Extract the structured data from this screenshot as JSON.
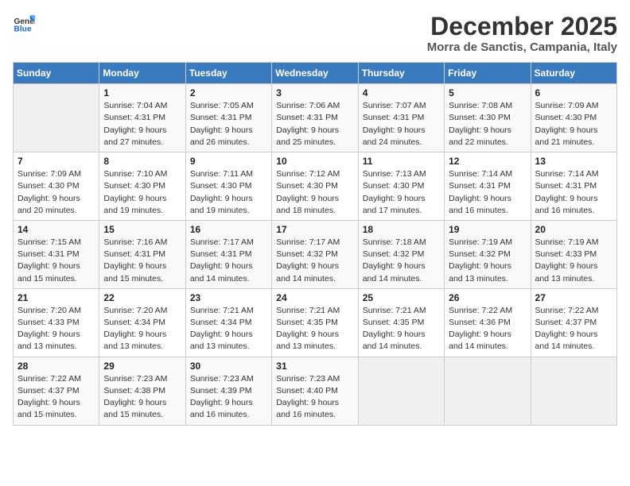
{
  "logo": {
    "line1": "General",
    "line2": "Blue"
  },
  "title": {
    "month_year": "December 2025",
    "location": "Morra de Sanctis, Campania, Italy"
  },
  "days_of_week": [
    "Sunday",
    "Monday",
    "Tuesday",
    "Wednesday",
    "Thursday",
    "Friday",
    "Saturday"
  ],
  "weeks": [
    [
      {
        "day": "",
        "info": ""
      },
      {
        "day": "1",
        "info": "Sunrise: 7:04 AM\nSunset: 4:31 PM\nDaylight: 9 hours\nand 27 minutes."
      },
      {
        "day": "2",
        "info": "Sunrise: 7:05 AM\nSunset: 4:31 PM\nDaylight: 9 hours\nand 26 minutes."
      },
      {
        "day": "3",
        "info": "Sunrise: 7:06 AM\nSunset: 4:31 PM\nDaylight: 9 hours\nand 25 minutes."
      },
      {
        "day": "4",
        "info": "Sunrise: 7:07 AM\nSunset: 4:31 PM\nDaylight: 9 hours\nand 24 minutes."
      },
      {
        "day": "5",
        "info": "Sunrise: 7:08 AM\nSunset: 4:30 PM\nDaylight: 9 hours\nand 22 minutes."
      },
      {
        "day": "6",
        "info": "Sunrise: 7:09 AM\nSunset: 4:30 PM\nDaylight: 9 hours\nand 21 minutes."
      }
    ],
    [
      {
        "day": "7",
        "info": "Sunrise: 7:09 AM\nSunset: 4:30 PM\nDaylight: 9 hours\nand 20 minutes."
      },
      {
        "day": "8",
        "info": "Sunrise: 7:10 AM\nSunset: 4:30 PM\nDaylight: 9 hours\nand 19 minutes."
      },
      {
        "day": "9",
        "info": "Sunrise: 7:11 AM\nSunset: 4:30 PM\nDaylight: 9 hours\nand 19 minutes."
      },
      {
        "day": "10",
        "info": "Sunrise: 7:12 AM\nSunset: 4:30 PM\nDaylight: 9 hours\nand 18 minutes."
      },
      {
        "day": "11",
        "info": "Sunrise: 7:13 AM\nSunset: 4:30 PM\nDaylight: 9 hours\nand 17 minutes."
      },
      {
        "day": "12",
        "info": "Sunrise: 7:14 AM\nSunset: 4:31 PM\nDaylight: 9 hours\nand 16 minutes."
      },
      {
        "day": "13",
        "info": "Sunrise: 7:14 AM\nSunset: 4:31 PM\nDaylight: 9 hours\nand 16 minutes."
      }
    ],
    [
      {
        "day": "14",
        "info": "Sunrise: 7:15 AM\nSunset: 4:31 PM\nDaylight: 9 hours\nand 15 minutes."
      },
      {
        "day": "15",
        "info": "Sunrise: 7:16 AM\nSunset: 4:31 PM\nDaylight: 9 hours\nand 15 minutes."
      },
      {
        "day": "16",
        "info": "Sunrise: 7:17 AM\nSunset: 4:31 PM\nDaylight: 9 hours\nand 14 minutes."
      },
      {
        "day": "17",
        "info": "Sunrise: 7:17 AM\nSunset: 4:32 PM\nDaylight: 9 hours\nand 14 minutes."
      },
      {
        "day": "18",
        "info": "Sunrise: 7:18 AM\nSunset: 4:32 PM\nDaylight: 9 hours\nand 14 minutes."
      },
      {
        "day": "19",
        "info": "Sunrise: 7:19 AM\nSunset: 4:32 PM\nDaylight: 9 hours\nand 13 minutes."
      },
      {
        "day": "20",
        "info": "Sunrise: 7:19 AM\nSunset: 4:33 PM\nDaylight: 9 hours\nand 13 minutes."
      }
    ],
    [
      {
        "day": "21",
        "info": "Sunrise: 7:20 AM\nSunset: 4:33 PM\nDaylight: 9 hours\nand 13 minutes."
      },
      {
        "day": "22",
        "info": "Sunrise: 7:20 AM\nSunset: 4:34 PM\nDaylight: 9 hours\nand 13 minutes."
      },
      {
        "day": "23",
        "info": "Sunrise: 7:21 AM\nSunset: 4:34 PM\nDaylight: 9 hours\nand 13 minutes."
      },
      {
        "day": "24",
        "info": "Sunrise: 7:21 AM\nSunset: 4:35 PM\nDaylight: 9 hours\nand 13 minutes."
      },
      {
        "day": "25",
        "info": "Sunrise: 7:21 AM\nSunset: 4:35 PM\nDaylight: 9 hours\nand 14 minutes."
      },
      {
        "day": "26",
        "info": "Sunrise: 7:22 AM\nSunset: 4:36 PM\nDaylight: 9 hours\nand 14 minutes."
      },
      {
        "day": "27",
        "info": "Sunrise: 7:22 AM\nSunset: 4:37 PM\nDaylight: 9 hours\nand 14 minutes."
      }
    ],
    [
      {
        "day": "28",
        "info": "Sunrise: 7:22 AM\nSunset: 4:37 PM\nDaylight: 9 hours\nand 15 minutes."
      },
      {
        "day": "29",
        "info": "Sunrise: 7:23 AM\nSunset: 4:38 PM\nDaylight: 9 hours\nand 15 minutes."
      },
      {
        "day": "30",
        "info": "Sunrise: 7:23 AM\nSunset: 4:39 PM\nDaylight: 9 hours\nand 16 minutes."
      },
      {
        "day": "31",
        "info": "Sunrise: 7:23 AM\nSunset: 4:40 PM\nDaylight: 9 hours\nand 16 minutes."
      },
      {
        "day": "",
        "info": ""
      },
      {
        "day": "",
        "info": ""
      },
      {
        "day": "",
        "info": ""
      }
    ]
  ]
}
